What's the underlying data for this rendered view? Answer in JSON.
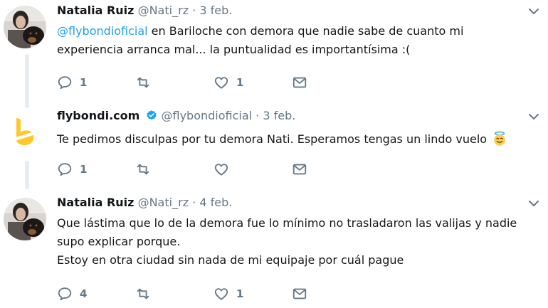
{
  "tweets": [
    {
      "name": "Natalia Ruiz",
      "handle": "@Nati_rz",
      "dot": "·",
      "date": "3 feb.",
      "text": {
        "mention": "@flybondioficial",
        "line1_rest": " en Bariloche con demora que nadie sabe de cuanto mi",
        "line2": "experiencia arranca mal... la puntualidad es importantísima :("
      },
      "actions": {
        "reply_count": "1",
        "retweet_count": "",
        "like_count": "1"
      }
    },
    {
      "name": "flybondi.com",
      "handle": "@flybondioficial",
      "dot": "·",
      "date": "3 feb.",
      "verified": true,
      "text": {
        "line1": "Te pedimos disculpas por tu demora Nati. Esperamos tengas un lindo vuelo",
        "emoji": "smiling-face-with-halo"
      },
      "actions": {
        "reply_count": "1",
        "retweet_count": "",
        "like_count": ""
      }
    },
    {
      "name": "Natalia Ruiz",
      "handle": "@Nati_rz",
      "dot": "·",
      "date": "4 feb.",
      "text": {
        "line1": "Que lástima que lo de la demora fue lo mínimo no trasladaron las valijas y nadie",
        "line2": "supo explicar porque.",
        "line3": "Estoy en otra ciudad sin nada de mi equipaje por cuál pague"
      },
      "actions": {
        "reply_count": "4",
        "retweet_count": "",
        "like_count": "1"
      }
    }
  ],
  "colors": {
    "text": "#14171a",
    "secondary": "#657786",
    "link": "#1da1f2",
    "thread_line": "#e6ecf0",
    "flybondi_yellow": "#ffc72c"
  }
}
